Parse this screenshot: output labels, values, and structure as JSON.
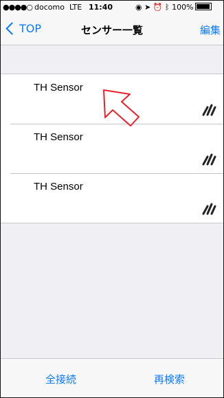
{
  "status_bar": {
    "carrier": "docomo",
    "network": "LTE",
    "time": "11:40",
    "battery": "100%"
  },
  "nav": {
    "back_label": "TOP",
    "title": "センサー一覧",
    "edit_label": "編集"
  },
  "sensors": [
    {
      "name": "TH Sensor"
    },
    {
      "name": "TH Sensor"
    },
    {
      "name": "TH Sensor"
    }
  ],
  "toolbar": {
    "connect_all_label": "全接続",
    "rescan_label": "再検索"
  },
  "colors": {
    "accent": "#0a7aff",
    "pointer_arrow": "#e8212b"
  },
  "icons": {
    "row_accessory": "signal-strength-icon",
    "annotation": "pointer-arrow-icon"
  }
}
